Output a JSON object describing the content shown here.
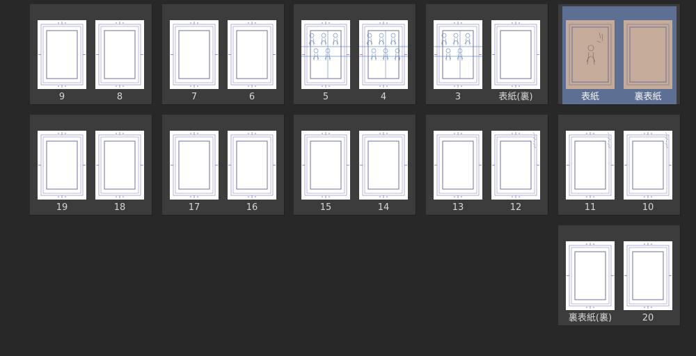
{
  "window": {
    "title": ""
  },
  "colors": {
    "background": "#282828",
    "panel": "#3c3c3c",
    "selection": "#5d6f93",
    "page": "#ffffff",
    "guide": "#7a76c2",
    "sketch": "#5b7fb8",
    "cover": "#c5ab99",
    "label": "#d6d6d6"
  },
  "spreads": [
    {
      "left": {
        "label": "9",
        "content": "blank"
      },
      "right": {
        "label": "8",
        "content": "blank"
      },
      "selected": false
    },
    {
      "left": {
        "label": "7",
        "content": "blank"
      },
      "right": {
        "label": "6",
        "content": "blank"
      },
      "selected": false
    },
    {
      "left": {
        "label": "5",
        "content": "sketch"
      },
      "right": {
        "label": "4",
        "content": "sketch"
      },
      "selected": false
    },
    {
      "left": {
        "label": "3",
        "content": "sketch"
      },
      "right": {
        "label": "表紙(裏)",
        "content": "blank"
      },
      "selected": false
    },
    {
      "left": {
        "label": "表紙",
        "content": "cover-sketch"
      },
      "right": {
        "label": "裏表紙",
        "content": "cover"
      },
      "selected": true
    },
    {
      "left": {
        "label": "19",
        "content": "blank"
      },
      "right": {
        "label": "18",
        "content": "blank"
      },
      "selected": false
    },
    {
      "left": {
        "label": "17",
        "content": "blank"
      },
      "right": {
        "label": "16",
        "content": "blank"
      },
      "selected": false
    },
    {
      "left": {
        "label": "15",
        "content": "blank"
      },
      "right": {
        "label": "14",
        "content": "blank"
      },
      "selected": false
    },
    {
      "left": {
        "label": "13",
        "content": "blank"
      },
      "right": {
        "label": "12",
        "content": "light-sketch"
      },
      "selected": false
    },
    {
      "left": {
        "label": "11",
        "content": "light-sketch"
      },
      "right": {
        "label": "10",
        "content": "light-sketch"
      },
      "selected": false
    },
    {
      "left": {
        "label": "裏表紙(裏)",
        "content": "blank"
      },
      "right": {
        "label": "20",
        "content": "blank"
      },
      "selected": false
    }
  ]
}
